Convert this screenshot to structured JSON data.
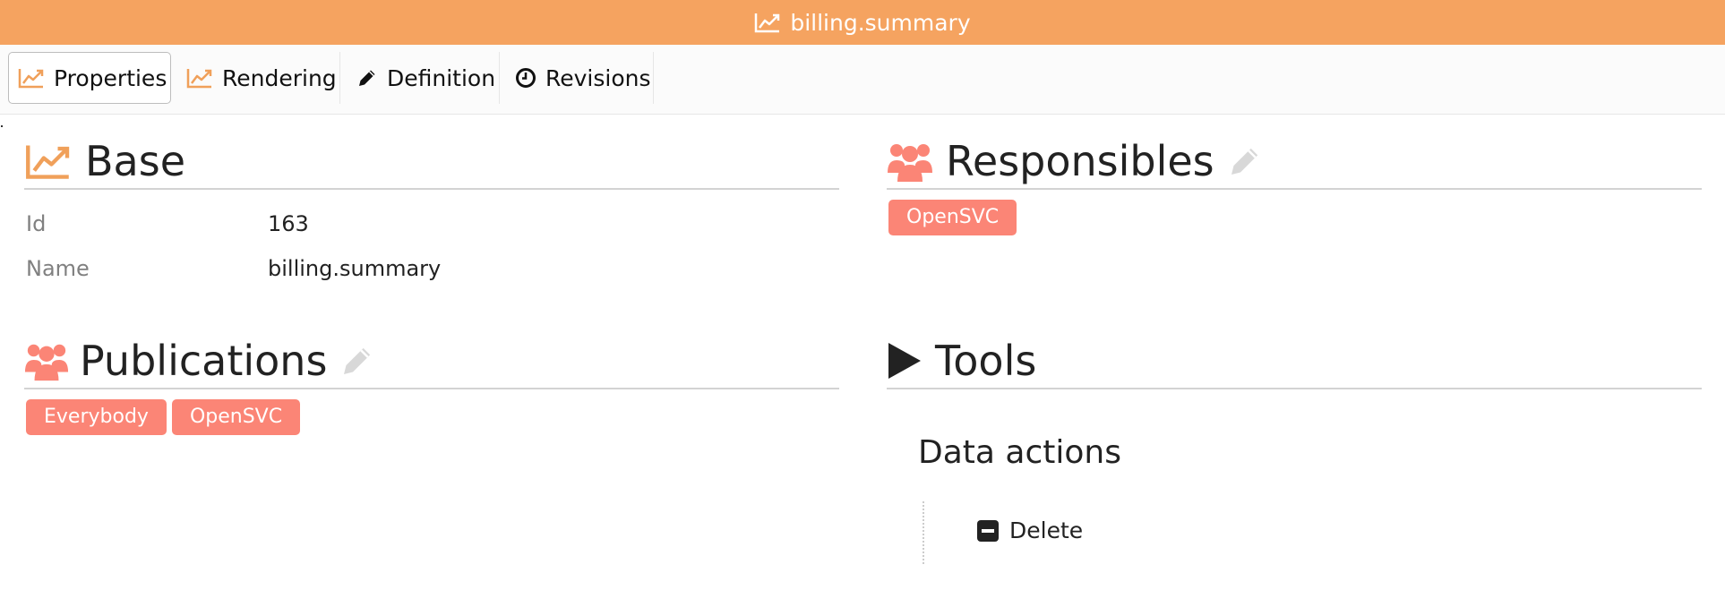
{
  "title": "billing.summary",
  "tabs": [
    {
      "label": "Properties",
      "icon": "chart-line-icon"
    },
    {
      "label": "Rendering",
      "icon": "chart-line-icon"
    },
    {
      "label": "Definition",
      "icon": "pencil-icon"
    },
    {
      "label": "Revisions",
      "icon": "clock-icon"
    }
  ],
  "base": {
    "heading": "Base",
    "rows": [
      {
        "key": "Id",
        "value": "163"
      },
      {
        "key": "Name",
        "value": "billing.summary"
      }
    ]
  },
  "responsibles": {
    "heading": "Responsibles",
    "tags": [
      "OpenSVC"
    ]
  },
  "publications": {
    "heading": "Publications",
    "tags": [
      "Everybody",
      "OpenSVC"
    ]
  },
  "tools": {
    "heading": "Tools",
    "subheading": "Data actions",
    "actions": [
      {
        "label": "Delete",
        "icon": "minus-square-icon"
      }
    ]
  },
  "colors": {
    "titlebar": "#f5a360",
    "accent_orange": "#f0a05a",
    "tag": "#fb8576",
    "edit_icon": "#d8d8d8",
    "tools_icon": "#222222"
  }
}
